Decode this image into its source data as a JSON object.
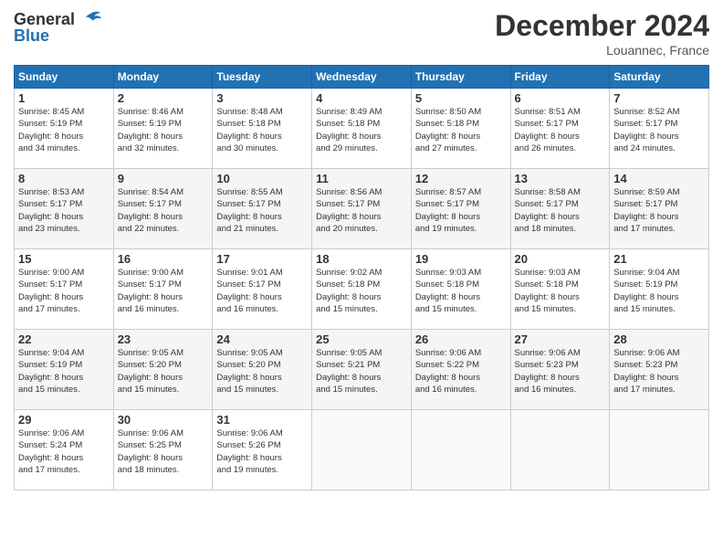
{
  "logo": {
    "line1": "General",
    "line2": "Blue"
  },
  "title": "December 2024",
  "location": "Louannec, France",
  "days_of_week": [
    "Sunday",
    "Monday",
    "Tuesday",
    "Wednesday",
    "Thursday",
    "Friday",
    "Saturday"
  ],
  "weeks": [
    [
      {
        "day": 1,
        "info": "Sunrise: 8:45 AM\nSunset: 5:19 PM\nDaylight: 8 hours\nand 34 minutes."
      },
      {
        "day": 2,
        "info": "Sunrise: 8:46 AM\nSunset: 5:19 PM\nDaylight: 8 hours\nand 32 minutes."
      },
      {
        "day": 3,
        "info": "Sunrise: 8:48 AM\nSunset: 5:18 PM\nDaylight: 8 hours\nand 30 minutes."
      },
      {
        "day": 4,
        "info": "Sunrise: 8:49 AM\nSunset: 5:18 PM\nDaylight: 8 hours\nand 29 minutes."
      },
      {
        "day": 5,
        "info": "Sunrise: 8:50 AM\nSunset: 5:18 PM\nDaylight: 8 hours\nand 27 minutes."
      },
      {
        "day": 6,
        "info": "Sunrise: 8:51 AM\nSunset: 5:17 PM\nDaylight: 8 hours\nand 26 minutes."
      },
      {
        "day": 7,
        "info": "Sunrise: 8:52 AM\nSunset: 5:17 PM\nDaylight: 8 hours\nand 24 minutes."
      }
    ],
    [
      {
        "day": 8,
        "info": "Sunrise: 8:53 AM\nSunset: 5:17 PM\nDaylight: 8 hours\nand 23 minutes."
      },
      {
        "day": 9,
        "info": "Sunrise: 8:54 AM\nSunset: 5:17 PM\nDaylight: 8 hours\nand 22 minutes."
      },
      {
        "day": 10,
        "info": "Sunrise: 8:55 AM\nSunset: 5:17 PM\nDaylight: 8 hours\nand 21 minutes."
      },
      {
        "day": 11,
        "info": "Sunrise: 8:56 AM\nSunset: 5:17 PM\nDaylight: 8 hours\nand 20 minutes."
      },
      {
        "day": 12,
        "info": "Sunrise: 8:57 AM\nSunset: 5:17 PM\nDaylight: 8 hours\nand 19 minutes."
      },
      {
        "day": 13,
        "info": "Sunrise: 8:58 AM\nSunset: 5:17 PM\nDaylight: 8 hours\nand 18 minutes."
      },
      {
        "day": 14,
        "info": "Sunrise: 8:59 AM\nSunset: 5:17 PM\nDaylight: 8 hours\nand 17 minutes."
      }
    ],
    [
      {
        "day": 15,
        "info": "Sunrise: 9:00 AM\nSunset: 5:17 PM\nDaylight: 8 hours\nand 17 minutes."
      },
      {
        "day": 16,
        "info": "Sunrise: 9:00 AM\nSunset: 5:17 PM\nDaylight: 8 hours\nand 16 minutes."
      },
      {
        "day": 17,
        "info": "Sunrise: 9:01 AM\nSunset: 5:17 PM\nDaylight: 8 hours\nand 16 minutes."
      },
      {
        "day": 18,
        "info": "Sunrise: 9:02 AM\nSunset: 5:18 PM\nDaylight: 8 hours\nand 15 minutes."
      },
      {
        "day": 19,
        "info": "Sunrise: 9:03 AM\nSunset: 5:18 PM\nDaylight: 8 hours\nand 15 minutes."
      },
      {
        "day": 20,
        "info": "Sunrise: 9:03 AM\nSunset: 5:18 PM\nDaylight: 8 hours\nand 15 minutes."
      },
      {
        "day": 21,
        "info": "Sunrise: 9:04 AM\nSunset: 5:19 PM\nDaylight: 8 hours\nand 15 minutes."
      }
    ],
    [
      {
        "day": 22,
        "info": "Sunrise: 9:04 AM\nSunset: 5:19 PM\nDaylight: 8 hours\nand 15 minutes."
      },
      {
        "day": 23,
        "info": "Sunrise: 9:05 AM\nSunset: 5:20 PM\nDaylight: 8 hours\nand 15 minutes."
      },
      {
        "day": 24,
        "info": "Sunrise: 9:05 AM\nSunset: 5:20 PM\nDaylight: 8 hours\nand 15 minutes."
      },
      {
        "day": 25,
        "info": "Sunrise: 9:05 AM\nSunset: 5:21 PM\nDaylight: 8 hours\nand 15 minutes."
      },
      {
        "day": 26,
        "info": "Sunrise: 9:06 AM\nSunset: 5:22 PM\nDaylight: 8 hours\nand 16 minutes."
      },
      {
        "day": 27,
        "info": "Sunrise: 9:06 AM\nSunset: 5:23 PM\nDaylight: 8 hours\nand 16 minutes."
      },
      {
        "day": 28,
        "info": "Sunrise: 9:06 AM\nSunset: 5:23 PM\nDaylight: 8 hours\nand 17 minutes."
      }
    ],
    [
      {
        "day": 29,
        "info": "Sunrise: 9:06 AM\nSunset: 5:24 PM\nDaylight: 8 hours\nand 17 minutes."
      },
      {
        "day": 30,
        "info": "Sunrise: 9:06 AM\nSunset: 5:25 PM\nDaylight: 8 hours\nand 18 minutes."
      },
      {
        "day": 31,
        "info": "Sunrise: 9:06 AM\nSunset: 5:26 PM\nDaylight: 8 hours\nand 19 minutes."
      },
      null,
      null,
      null,
      null
    ]
  ]
}
